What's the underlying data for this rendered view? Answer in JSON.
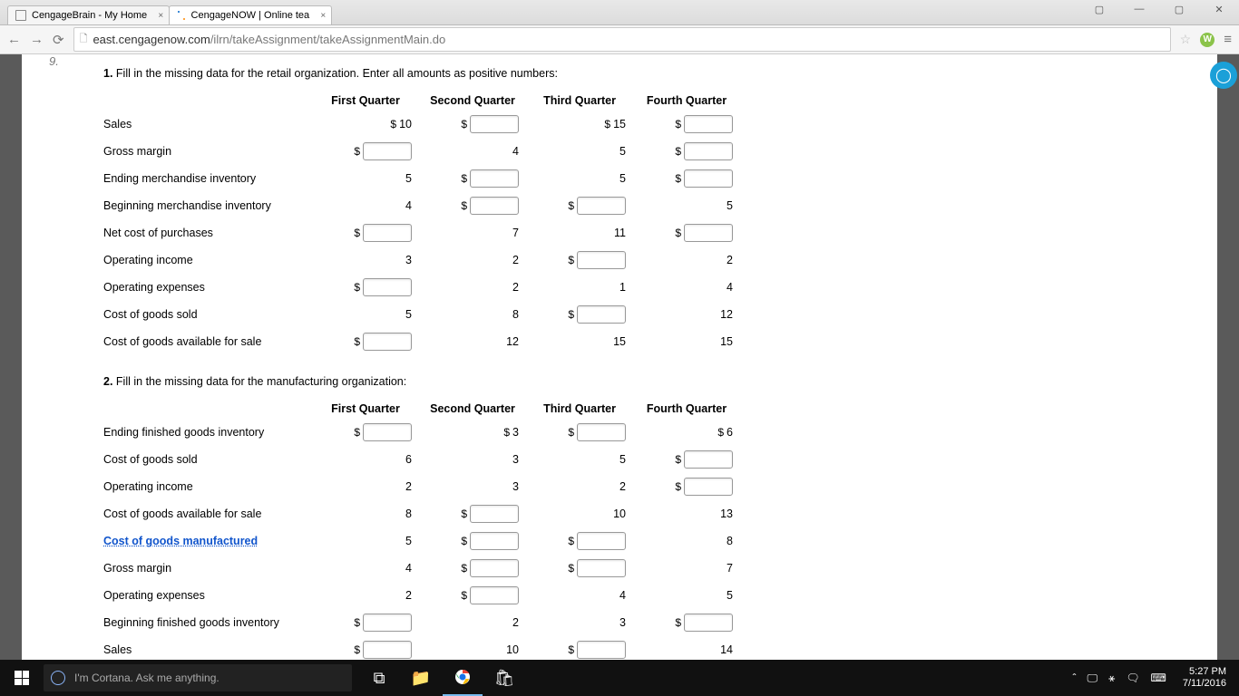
{
  "browser": {
    "tabs": [
      {
        "title": "CengageBrain - My Home"
      },
      {
        "title": "CengageNOW | Online tea"
      }
    ],
    "url_host": "east.cengagenow.com",
    "url_path": "/ilrn/takeAssignment/takeAssignmentMain.do"
  },
  "page": {
    "qnum": "9.",
    "q1_prefix": "1.",
    "q1_text": "Fill in the missing data for the retail organization. Enter all amounts as positive numbers:",
    "q2_prefix": "2.",
    "q2_text": "Fill in the missing data for the manufacturing organization:",
    "headers": [
      "First Quarter",
      "Second Quarter",
      "Third Quarter",
      "Fourth Quarter"
    ],
    "table1": [
      {
        "label": "Sales",
        "cells": [
          {
            "type": "text",
            "dollar": true,
            "value": "10"
          },
          {
            "type": "input",
            "dollar": true
          },
          {
            "type": "text",
            "dollar": true,
            "value": "15"
          },
          {
            "type": "input",
            "dollar": true
          }
        ]
      },
      {
        "label": "Gross margin",
        "cells": [
          {
            "type": "input",
            "dollar": true
          },
          {
            "type": "text",
            "value": "4"
          },
          {
            "type": "text",
            "value": "5"
          },
          {
            "type": "input",
            "dollar": true
          }
        ]
      },
      {
        "label": "Ending merchandise inventory",
        "cells": [
          {
            "type": "text",
            "value": "5"
          },
          {
            "type": "input",
            "dollar": true
          },
          {
            "type": "text",
            "value": "5"
          },
          {
            "type": "input",
            "dollar": true
          }
        ]
      },
      {
        "label": "Beginning merchandise inventory",
        "cells": [
          {
            "type": "text",
            "value": "4"
          },
          {
            "type": "input",
            "dollar": true
          },
          {
            "type": "input",
            "dollar": true
          },
          {
            "type": "text",
            "value": "5"
          }
        ]
      },
      {
        "label": "Net cost of purchases",
        "cells": [
          {
            "type": "input",
            "dollar": true
          },
          {
            "type": "text",
            "value": "7"
          },
          {
            "type": "text",
            "value": "11"
          },
          {
            "type": "input",
            "dollar": true
          }
        ]
      },
      {
        "label": "Operating income",
        "cells": [
          {
            "type": "text",
            "value": "3"
          },
          {
            "type": "text",
            "value": "2"
          },
          {
            "type": "input",
            "dollar": true
          },
          {
            "type": "text",
            "value": "2"
          }
        ]
      },
      {
        "label": "Operating expenses",
        "cells": [
          {
            "type": "input",
            "dollar": true
          },
          {
            "type": "text",
            "value": "2"
          },
          {
            "type": "text",
            "value": "1"
          },
          {
            "type": "text",
            "value": "4"
          }
        ]
      },
      {
        "label": "Cost of goods sold",
        "cells": [
          {
            "type": "text",
            "value": "5"
          },
          {
            "type": "text",
            "value": "8"
          },
          {
            "type": "input",
            "dollar": true
          },
          {
            "type": "text",
            "value": "12"
          }
        ]
      },
      {
        "label": "Cost of goods available for sale",
        "cells": [
          {
            "type": "input",
            "dollar": true
          },
          {
            "type": "text",
            "value": "12"
          },
          {
            "type": "text",
            "value": "15"
          },
          {
            "type": "text",
            "value": "15"
          }
        ]
      }
    ],
    "table2": [
      {
        "label": "Ending finished goods inventory",
        "cells": [
          {
            "type": "input",
            "dollar": true
          },
          {
            "type": "text",
            "dollar": true,
            "value": "3"
          },
          {
            "type": "input",
            "dollar": true
          },
          {
            "type": "text",
            "dollar": true,
            "value": "6"
          }
        ]
      },
      {
        "label": "Cost of goods sold",
        "cells": [
          {
            "type": "text",
            "value": "6"
          },
          {
            "type": "text",
            "value": "3"
          },
          {
            "type": "text",
            "value": "5"
          },
          {
            "type": "input",
            "dollar": true
          }
        ]
      },
      {
        "label": "Operating income",
        "cells": [
          {
            "type": "text",
            "value": "2"
          },
          {
            "type": "text",
            "value": "3"
          },
          {
            "type": "text",
            "value": "2"
          },
          {
            "type": "input",
            "dollar": true
          }
        ]
      },
      {
        "label": "Cost of goods available for sale",
        "cells": [
          {
            "type": "text",
            "value": "8"
          },
          {
            "type": "input",
            "dollar": true
          },
          {
            "type": "text",
            "value": "10"
          },
          {
            "type": "text",
            "value": "13"
          }
        ]
      },
      {
        "label": "Cost of goods manufactured",
        "link": true,
        "cells": [
          {
            "type": "text",
            "value": "5"
          },
          {
            "type": "input",
            "dollar": true
          },
          {
            "type": "input",
            "dollar": true
          },
          {
            "type": "text",
            "value": "8"
          }
        ]
      },
      {
        "label": "Gross margin",
        "cells": [
          {
            "type": "text",
            "value": "4"
          },
          {
            "type": "input",
            "dollar": true
          },
          {
            "type": "input",
            "dollar": true
          },
          {
            "type": "text",
            "value": "7"
          }
        ]
      },
      {
        "label": "Operating expenses",
        "cells": [
          {
            "type": "text",
            "value": "2"
          },
          {
            "type": "input",
            "dollar": true
          },
          {
            "type": "text",
            "value": "4"
          },
          {
            "type": "text",
            "value": "5"
          }
        ]
      },
      {
        "label": "Beginning finished goods inventory",
        "cells": [
          {
            "type": "input",
            "dollar": true
          },
          {
            "type": "text",
            "value": "2"
          },
          {
            "type": "text",
            "value": "3"
          },
          {
            "type": "input",
            "dollar": true
          }
        ]
      },
      {
        "label": "Sales",
        "cells": [
          {
            "type": "input",
            "dollar": true
          },
          {
            "type": "text",
            "value": "10"
          },
          {
            "type": "input",
            "dollar": true
          },
          {
            "type": "text",
            "value": "14"
          }
        ]
      }
    ]
  },
  "taskbar": {
    "cortana": "I'm Cortana. Ask me anything.",
    "time": "5:27 PM",
    "date": "7/11/2016"
  }
}
